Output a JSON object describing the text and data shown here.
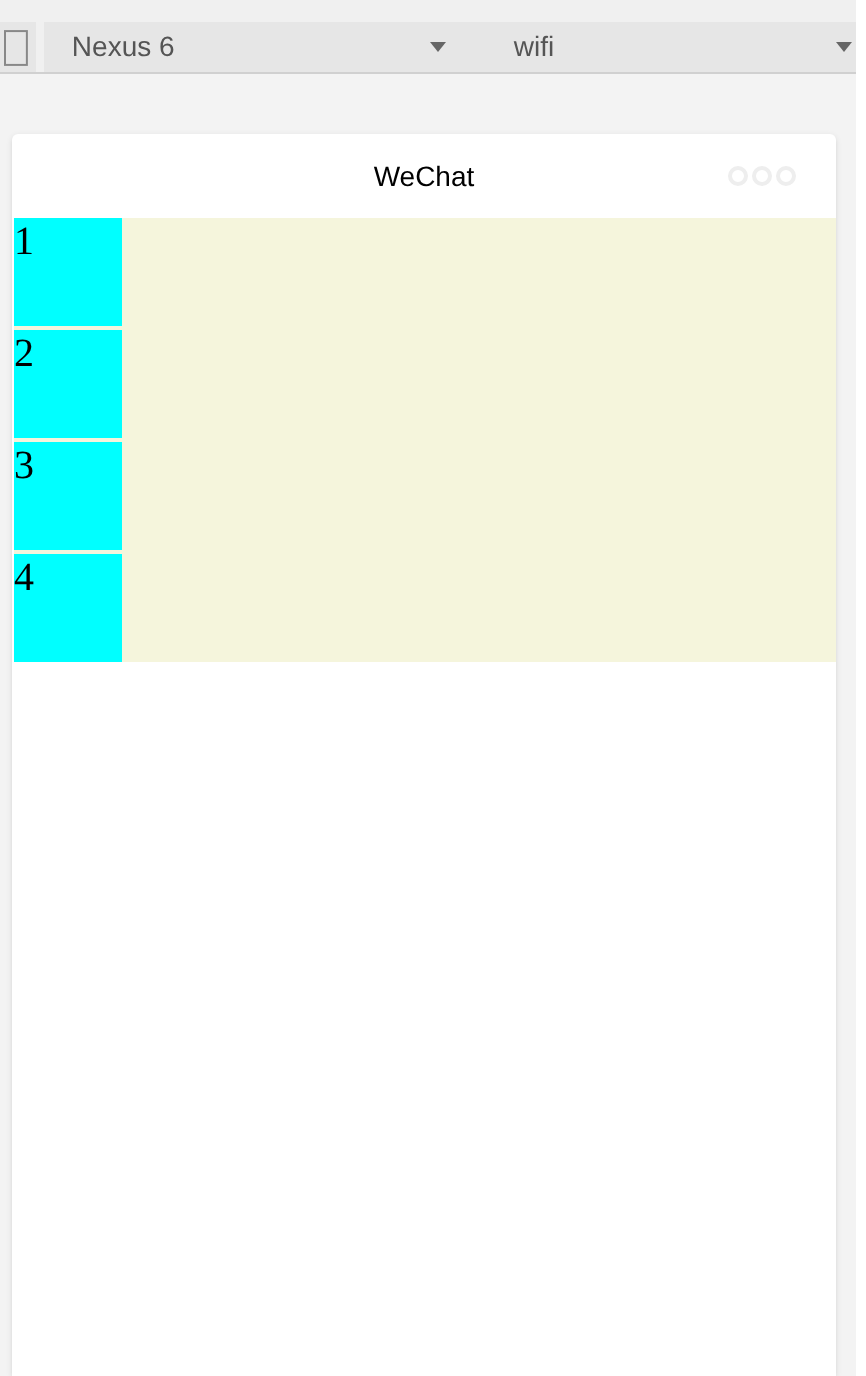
{
  "toolbar": {
    "device": "Nexus 6",
    "network": "wifi"
  },
  "nav_bar": {
    "title": "WeChat"
  },
  "items": [
    {
      "label": "1"
    },
    {
      "label": "2"
    },
    {
      "label": "3"
    },
    {
      "label": "4"
    }
  ]
}
